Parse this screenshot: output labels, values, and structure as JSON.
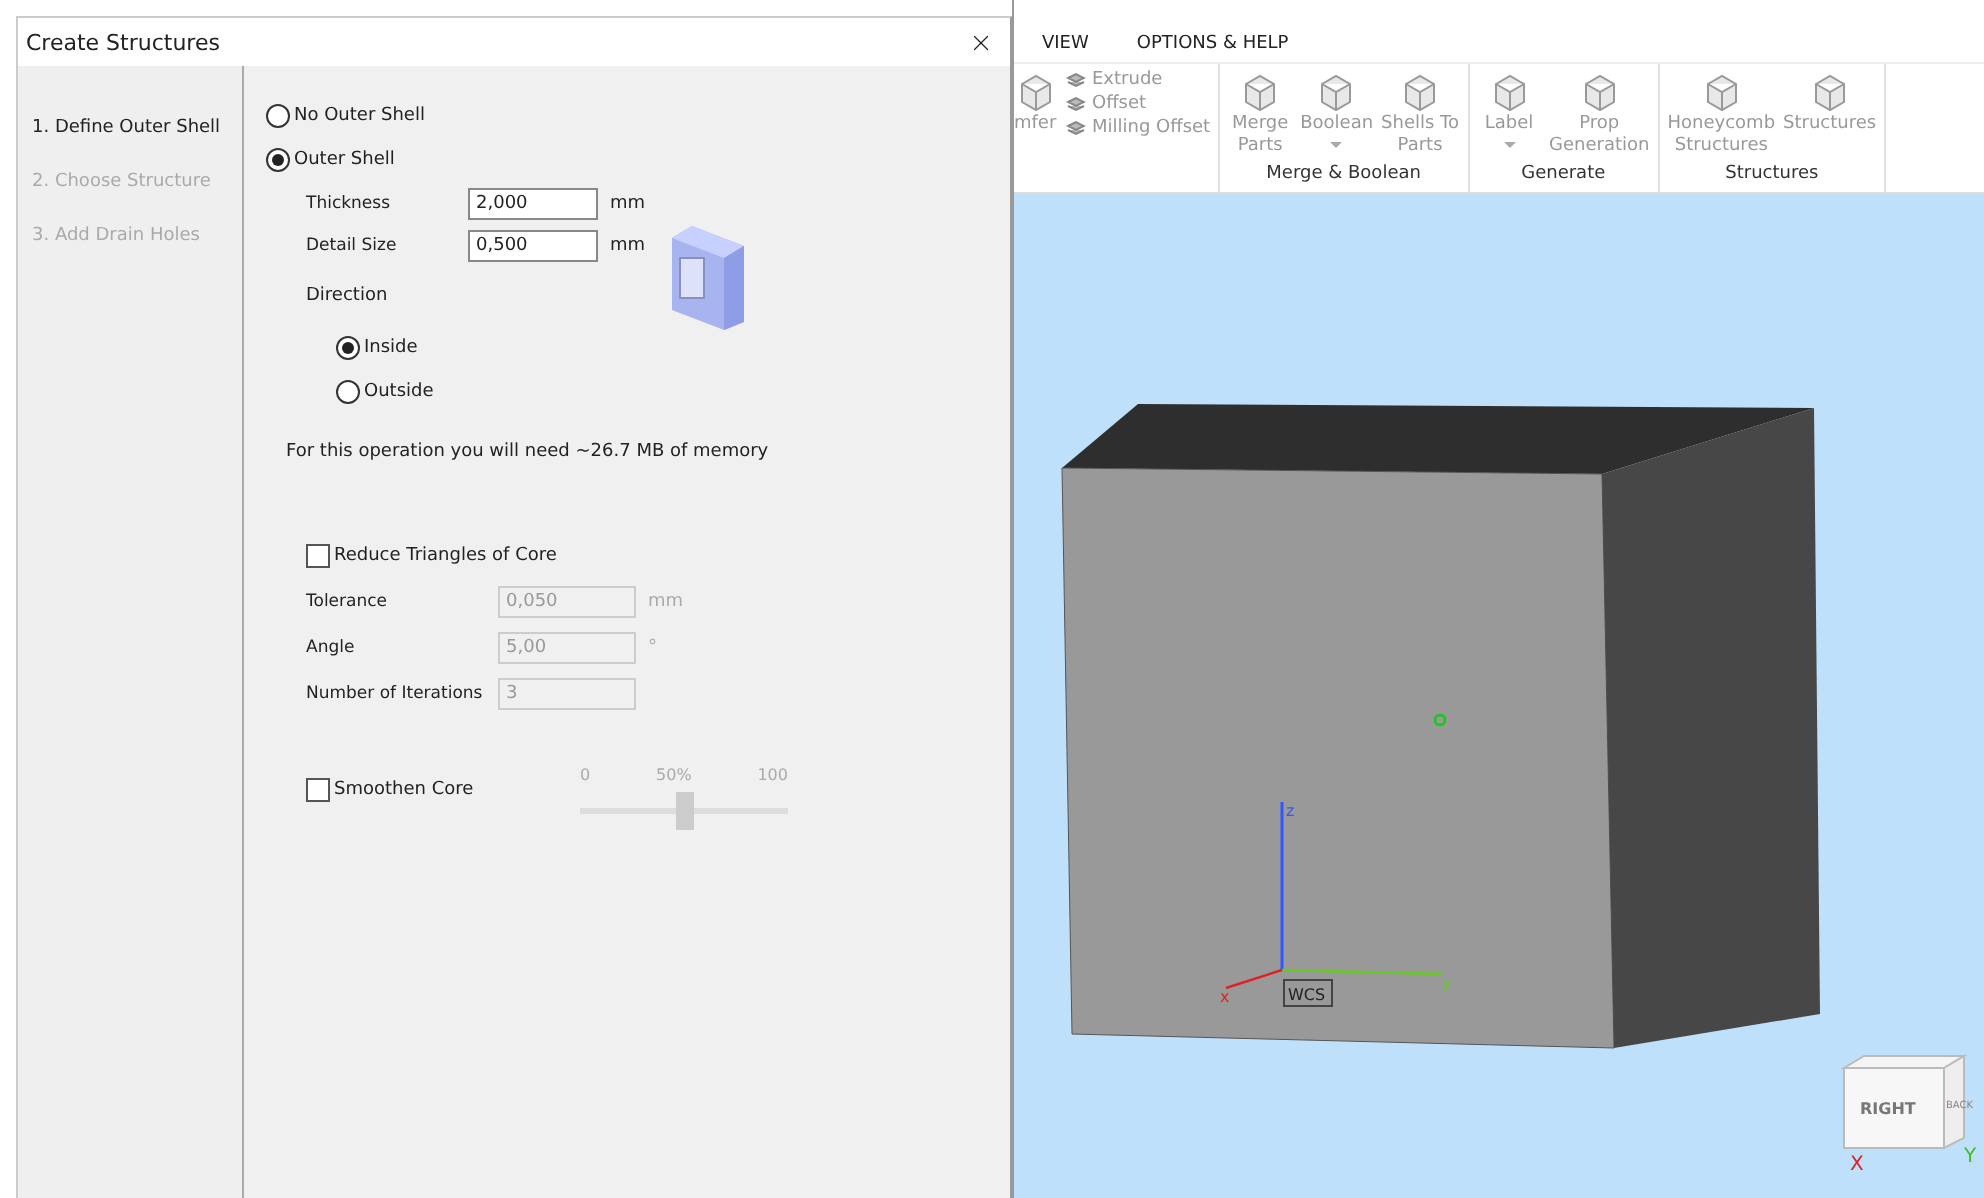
{
  "dialog": {
    "title": "Create Structures",
    "steps": [
      {
        "label": "1. Define Outer Shell",
        "selected": true
      },
      {
        "label": "2. Choose Structure",
        "selected": false
      },
      {
        "label": "3. Add Drain Holes",
        "selected": false
      }
    ],
    "shell_options": [
      {
        "label": "No Outer Shell",
        "selected": false
      },
      {
        "label": "Outer Shell",
        "selected": true
      }
    ],
    "fields": [
      {
        "label": "Thickness",
        "value": "2,000",
        "unit": "mm"
      },
      {
        "label": "Detail Size",
        "value": "0,500",
        "unit": "mm"
      }
    ],
    "direction": {
      "label": "Direction",
      "options": [
        {
          "label": "Inside",
          "selected": true
        },
        {
          "label": "Outside",
          "selected": false
        }
      ]
    },
    "memory_note": "For this operation you will need ~26.7 MB of memory",
    "reduce": {
      "label": "Reduce Triangles of Core",
      "checked": false
    },
    "reduce_fields": [
      {
        "label": "Tolerance",
        "value": "0,050",
        "unit": "mm",
        "disabled": true
      },
      {
        "label": "Angle",
        "value": "5,00",
        "unit": "°",
        "disabled": true
      },
      {
        "label": "Number of Iterations",
        "value": "3",
        "disabled": true
      }
    ],
    "smoothen": {
      "label": "Smoothen Core",
      "checked": false
    },
    "slider": {
      "min_label": "0",
      "mid_label": "50%",
      "max_label": "100",
      "level": 0.5,
      "disabled": true
    }
  },
  "ribbon": {
    "tabs": [
      "VIEW",
      "OPTIONS & HELP"
    ],
    "disabled": true,
    "groups": [
      {
        "items": [
          {
            "kind": "large",
            "label": "mfer"
          },
          {
            "kind": "small",
            "label": "Extrude"
          },
          {
            "kind": "small",
            "label": "Offset"
          },
          {
            "kind": "small",
            "label": "Milling Offset"
          }
        ]
      },
      {
        "title": "Merge & Boolean",
        "items": [
          {
            "kind": "large",
            "label": "Merge\nParts"
          },
          {
            "kind": "large",
            "label": "Boolean",
            "dropdown": true
          },
          {
            "kind": "large",
            "label": "Shells To\nParts"
          }
        ]
      },
      {
        "title": "Generate",
        "items": [
          {
            "kind": "large",
            "label": "Label",
            "dropdown": true
          },
          {
            "kind": "large",
            "label": "Prop\nGeneration"
          }
        ]
      },
      {
        "title": "Structures",
        "items": [
          {
            "kind": "large",
            "label": "Honeycomb\nStructures"
          },
          {
            "kind": "large",
            "label": "Structures"
          }
        ]
      }
    ]
  },
  "viewport": {
    "axis_labels": {
      "x": "x",
      "y": "y",
      "z": "z"
    },
    "wcs": "WCS",
    "view_cube": {
      "face": "RIGHT",
      "side": "BACK",
      "x": "X",
      "y": "Y"
    }
  }
}
